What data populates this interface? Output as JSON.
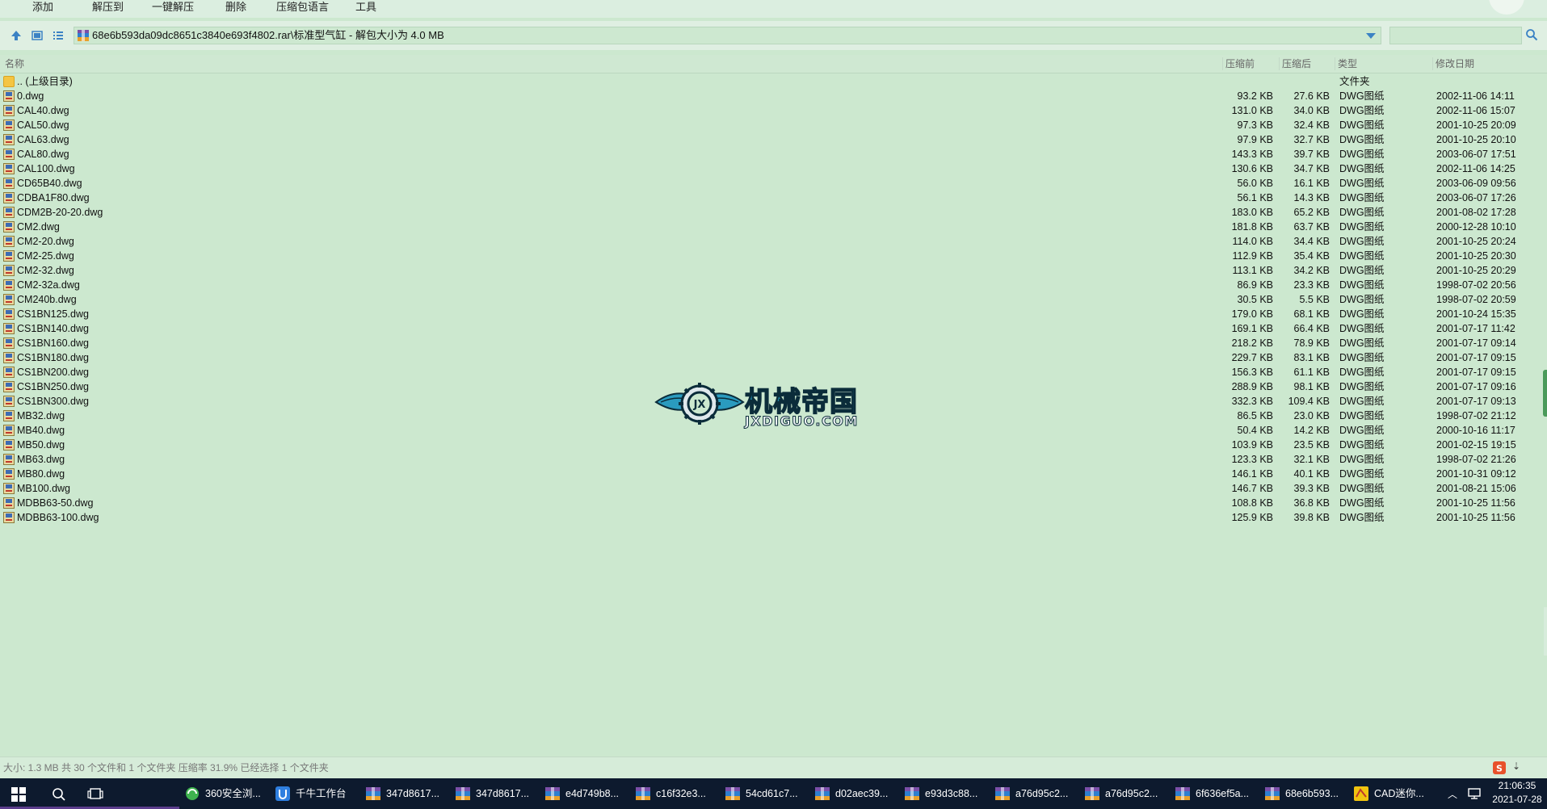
{
  "menu": {
    "items": [
      {
        "id": "add",
        "label": "添加"
      },
      {
        "id": "extract_to",
        "label": "解压到"
      },
      {
        "id": "one_click_extract",
        "label": "一键解压"
      },
      {
        "id": "delete",
        "label": "删除"
      },
      {
        "id": "archive_language",
        "label": "压缩包语言"
      },
      {
        "id": "tools",
        "label": "工具"
      }
    ]
  },
  "address": {
    "path": "68e6b593da09dc8651c3840e693f4802.rar\\标准型气缸 - 解包大小为 4.0 MB",
    "search_value": ""
  },
  "columns": {
    "name": "名称",
    "size": "压缩前",
    "packed": "压缩后",
    "type": "类型",
    "modified": "修改日期"
  },
  "parent_row": {
    "name": ".. (上级目录)",
    "type": "文件夹"
  },
  "files": [
    {
      "name": "0.dwg",
      "size": "93.2 KB",
      "packed": "27.6 KB",
      "type": "DWG图纸",
      "modified": "2002-11-06 14:11"
    },
    {
      "name": "CAL40.dwg",
      "size": "131.0 KB",
      "packed": "34.0 KB",
      "type": "DWG图纸",
      "modified": "2002-11-06 15:07"
    },
    {
      "name": "CAL50.dwg",
      "size": "97.3 KB",
      "packed": "32.4 KB",
      "type": "DWG图纸",
      "modified": "2001-10-25 20:09"
    },
    {
      "name": "CAL63.dwg",
      "size": "97.9 KB",
      "packed": "32.7 KB",
      "type": "DWG图纸",
      "modified": "2001-10-25 20:10"
    },
    {
      "name": "CAL80.dwg",
      "size": "143.3 KB",
      "packed": "39.7 KB",
      "type": "DWG图纸",
      "modified": "2003-06-07 17:51"
    },
    {
      "name": "CAL100.dwg",
      "size": "130.6 KB",
      "packed": "34.7 KB",
      "type": "DWG图纸",
      "modified": "2002-11-06 14:25"
    },
    {
      "name": "CD65B40.dwg",
      "size": "56.0 KB",
      "packed": "16.1 KB",
      "type": "DWG图纸",
      "modified": "2003-06-09 09:56"
    },
    {
      "name": "CDBA1F80.dwg",
      "size": "56.1 KB",
      "packed": "14.3 KB",
      "type": "DWG图纸",
      "modified": "2003-06-07 17:26"
    },
    {
      "name": "CDM2B-20-20.dwg",
      "size": "183.0 KB",
      "packed": "65.2 KB",
      "type": "DWG图纸",
      "modified": "2001-08-02 17:28"
    },
    {
      "name": "CM2.dwg",
      "size": "181.8 KB",
      "packed": "63.7 KB",
      "type": "DWG图纸",
      "modified": "2000-12-28 10:10"
    },
    {
      "name": "CM2-20.dwg",
      "size": "114.0 KB",
      "packed": "34.4 KB",
      "type": "DWG图纸",
      "modified": "2001-10-25 20:24"
    },
    {
      "name": "CM2-25.dwg",
      "size": "112.9 KB",
      "packed": "35.4 KB",
      "type": "DWG图纸",
      "modified": "2001-10-25 20:30"
    },
    {
      "name": "CM2-32.dwg",
      "size": "113.1 KB",
      "packed": "34.2 KB",
      "type": "DWG图纸",
      "modified": "2001-10-25 20:29"
    },
    {
      "name": "CM2-32a.dwg",
      "size": "86.9 KB",
      "packed": "23.3 KB",
      "type": "DWG图纸",
      "modified": "1998-07-02 20:56"
    },
    {
      "name": "CM240b.dwg",
      "size": "30.5 KB",
      "packed": "5.5 KB",
      "type": "DWG图纸",
      "modified": "1998-07-02 20:59"
    },
    {
      "name": "CS1BN125.dwg",
      "size": "179.0 KB",
      "packed": "68.1 KB",
      "type": "DWG图纸",
      "modified": "2001-10-24 15:35"
    },
    {
      "name": "CS1BN140.dwg",
      "size": "169.1 KB",
      "packed": "66.4 KB",
      "type": "DWG图纸",
      "modified": "2001-07-17 11:42"
    },
    {
      "name": "CS1BN160.dwg",
      "size": "218.2 KB",
      "packed": "78.9 KB",
      "type": "DWG图纸",
      "modified": "2001-07-17 09:14"
    },
    {
      "name": "CS1BN180.dwg",
      "size": "229.7 KB",
      "packed": "83.1 KB",
      "type": "DWG图纸",
      "modified": "2001-07-17 09:15"
    },
    {
      "name": "CS1BN200.dwg",
      "size": "156.3 KB",
      "packed": "61.1 KB",
      "type": "DWG图纸",
      "modified": "2001-07-17 09:15"
    },
    {
      "name": "CS1BN250.dwg",
      "size": "288.9 KB",
      "packed": "98.1 KB",
      "type": "DWG图纸",
      "modified": "2001-07-17 09:16"
    },
    {
      "name": "CS1BN300.dwg",
      "size": "332.3 KB",
      "packed": "109.4 KB",
      "type": "DWG图纸",
      "modified": "2001-07-17 09:13"
    },
    {
      "name": "MB32.dwg",
      "size": "86.5 KB",
      "packed": "23.0 KB",
      "type": "DWG图纸",
      "modified": "1998-07-02 21:12"
    },
    {
      "name": "MB40.dwg",
      "size": "50.4 KB",
      "packed": "14.2 KB",
      "type": "DWG图纸",
      "modified": "2000-10-16 11:17"
    },
    {
      "name": "MB50.dwg",
      "size": "103.9 KB",
      "packed": "23.5 KB",
      "type": "DWG图纸",
      "modified": "2001-02-15 19:15"
    },
    {
      "name": "MB63.dwg",
      "size": "123.3 KB",
      "packed": "32.1 KB",
      "type": "DWG图纸",
      "modified": "1998-07-02 21:26"
    },
    {
      "name": "MB80.dwg",
      "size": "146.1 KB",
      "packed": "40.1 KB",
      "type": "DWG图纸",
      "modified": "2001-10-31 09:12"
    },
    {
      "name": "MB100.dwg",
      "size": "146.7 KB",
      "packed": "39.3 KB",
      "type": "DWG图纸",
      "modified": "2001-08-21 15:06"
    },
    {
      "name": "MDBB63-50.dwg",
      "size": "108.8 KB",
      "packed": "36.8 KB",
      "type": "DWG图纸",
      "modified": "2001-10-25 11:56"
    },
    {
      "name": "MDBB63-100.dwg",
      "size": "125.9 KB",
      "packed": "39.8 KB",
      "type": "DWG图纸",
      "modified": "2001-10-25 11:56"
    }
  ],
  "watermark": {
    "cn": "机械帝国",
    "en": "JXDIGUO.COM",
    "badge": "JX"
  },
  "status": {
    "text": "大小: 1.3 MB 共 30 个文件和 1 个文件夹 压缩率 31.9% 已经选择 1 个文件夹"
  },
  "taskbar": {
    "items": [
      {
        "label": "360安全浏...",
        "icon": "browser-360-icon"
      },
      {
        "label": "千牛工作台",
        "icon": "qianniu-icon"
      },
      {
        "label": "347d8617...",
        "icon": "archive-icon"
      },
      {
        "label": "347d8617...",
        "icon": "archive-icon"
      },
      {
        "label": "e4d749b8...",
        "icon": "archive-icon"
      },
      {
        "label": "c16f32e3...",
        "icon": "archive-icon"
      },
      {
        "label": "54cd61c7...",
        "icon": "archive-icon"
      },
      {
        "label": "d02aec39...",
        "icon": "archive-icon"
      },
      {
        "label": "e93d3c88...",
        "icon": "archive-icon"
      },
      {
        "label": "a76d95c2...",
        "icon": "archive-icon"
      },
      {
        "label": "a76d95c2...",
        "icon": "archive-icon"
      },
      {
        "label": "6f636ef5a...",
        "icon": "archive-icon"
      },
      {
        "label": "68e6b593...",
        "icon": "archive-icon"
      },
      {
        "label": "CAD迷你...",
        "icon": "cad-mini-icon"
      }
    ],
    "clock": {
      "time": "21:06:35",
      "date": "2021-07-28"
    }
  },
  "colors": {
    "content_bg": "#cce8cf",
    "taskbar_bg": "#0d1a2e",
    "accent": "#3b82c4",
    "watermark_blue": "#1f8fb0"
  }
}
